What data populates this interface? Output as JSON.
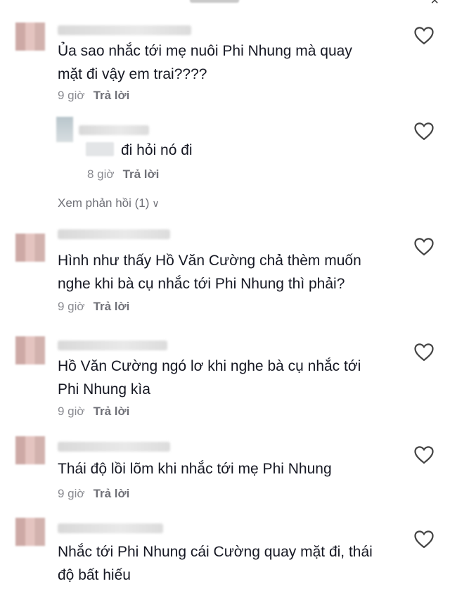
{
  "comments": [
    {
      "text_lines": [
        "Ủa sao nhắc tới mẹ nuôi Phi Nhung mà quay",
        "mặt đi vậy em trai????"
      ],
      "time": "9 giờ",
      "reply": "Trả lời"
    },
    {
      "text": "đi hỏi nó đi",
      "time": "8 giờ",
      "reply": "Trả lời"
    },
    {
      "view_replies": "Xem phản hồi (1)"
    },
    {
      "text_lines": [
        "Hình như thấy Hồ Văn Cường chả thèm muốn",
        "nghe khi bà cụ nhắc tới Phi Nhung thì phải?"
      ],
      "time": "9 giờ",
      "reply": "Trả lời"
    },
    {
      "text_lines": [
        "Hồ Văn Cường ngó lơ khi nghe bà cụ nhắc tới",
        "Phi Nhung kìa"
      ],
      "time": "9 giờ",
      "reply": "Trả lời"
    },
    {
      "text_lines": [
        "Thái độ lồi lõm khi nhắc tới mẹ Phi Nhung"
      ],
      "time": "9 giờ",
      "reply": "Trả lời"
    },
    {
      "text_lines": [
        "Nhắc tới Phi Nhung cái Cường quay mặt đi, thái",
        "độ bất hiếu"
      ]
    }
  ],
  "icons": {
    "like": "heart-outline-icon",
    "close": "close-icon",
    "expand": "chevron-down-icon"
  },
  "colors": {
    "text": "#161823",
    "meta": "#8a8b91",
    "reply": "#6f7077"
  }
}
